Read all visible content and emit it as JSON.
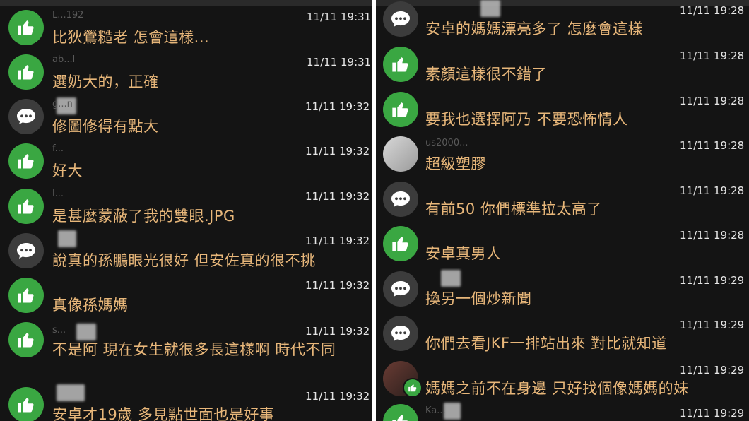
{
  "left_comments": [
    {
      "name": "L...192",
      "time": "11/11 19:31",
      "text": "比狄鶯糙老  怎會這樣...",
      "icon": "like-icon"
    },
    {
      "name": "ab...l",
      "time": "11/11 19:31",
      "text": "選奶大的，正確",
      "icon": "like-icon"
    },
    {
      "name": "g...n",
      "time": "11/11 19:32",
      "text": "修圖修得有點大",
      "icon": "comment-icon"
    },
    {
      "name": "f...",
      "time": "11/11 19:32",
      "text": "好大",
      "icon": "like-icon"
    },
    {
      "name": "l...",
      "time": "11/11 19:32",
      "text": "是甚麼蒙蔽了我的雙眼.JPG",
      "icon": "like-icon"
    },
    {
      "name": "",
      "time": "11/11 19:32",
      "text": "說真的孫鵬眼光很好  但安佐真的很不挑",
      "icon": "comment-icon"
    },
    {
      "name": "",
      "time": "11/11 19:32",
      "text": "真像孫媽媽",
      "icon": "like-icon"
    },
    {
      "name": "s...",
      "time": "11/11 19:32",
      "text": "不是阿 現在女生就很多長這樣啊 時代不同",
      "icon": "like-icon"
    },
    {
      "name": "",
      "time": "11/11 19:32",
      "text": "安卓才19歲 多見點世面也是好事",
      "icon": "like-icon"
    }
  ],
  "right_comments": [
    {
      "name": "",
      "time": "11/11 19:28",
      "text": "安卓的媽媽漂亮多了 怎麼會這樣",
      "icon": "comment-icon"
    },
    {
      "name": "",
      "time": "11/11 19:28",
      "text": "素顏這樣很不錯了",
      "icon": "like-icon"
    },
    {
      "name": "",
      "time": "11/11 19:28",
      "text": "要我也選擇阿乃 不要恐怖情人",
      "icon": "like-icon"
    },
    {
      "name": "us2000...",
      "time": "11/11 19:28",
      "text": "超級塑膠",
      "icon": "photo-avatar"
    },
    {
      "name": "",
      "time": "11/11 19:28",
      "text": "有前50 你們標準拉太高了",
      "icon": "comment-icon"
    },
    {
      "name": "",
      "time": "11/11 19:28",
      "text": "安卓真男人",
      "icon": "like-icon"
    },
    {
      "name": "",
      "time": "11/11 19:29",
      "text": "換另一個炒新聞",
      "icon": "comment-icon"
    },
    {
      "name": "",
      "time": "11/11 19:29",
      "text": "你們去看JKF一排站出來 對比就知道",
      "icon": "comment-icon"
    },
    {
      "name": "",
      "time": "11/11 19:29",
      "text": "媽媽之前不在身邊 只好找個像媽媽的妹",
      "icon": "photo-like"
    },
    {
      "name": "Ka...",
      "time": "11/11 19:29",
      "text": "",
      "icon": "like-icon"
    }
  ],
  "colors": {
    "like": "#3aa742",
    "comment_bg": "#3c3c3c",
    "text": "#e8b77a",
    "timestamp": "#e6e6e6",
    "background": "#141414"
  }
}
